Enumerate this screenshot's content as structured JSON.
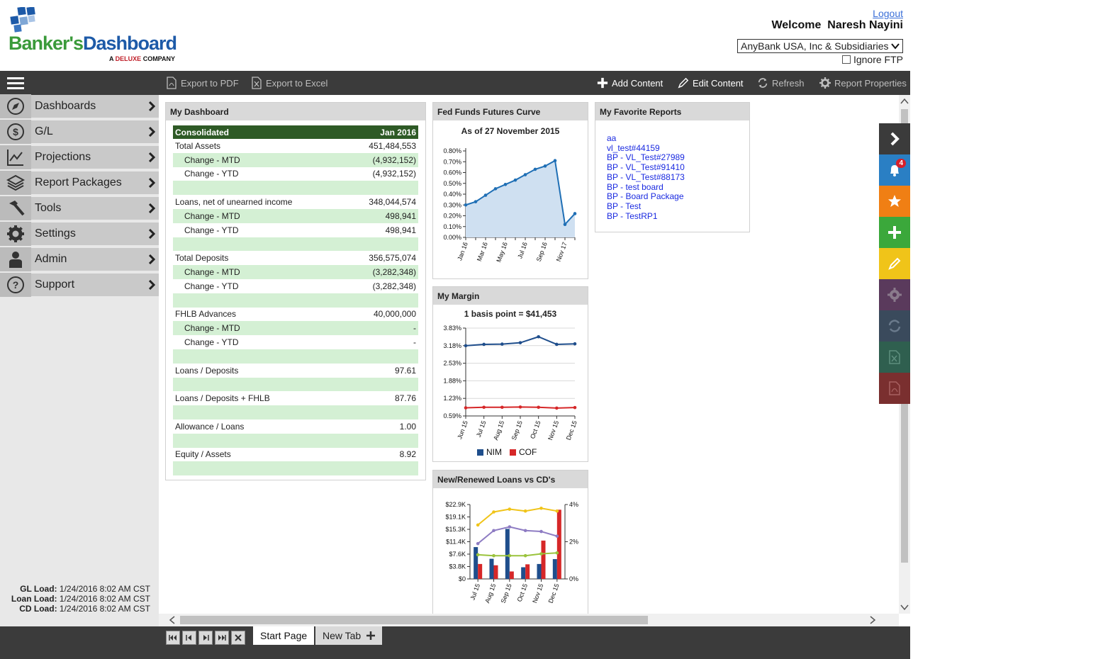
{
  "header": {
    "logo_part1": "Banker's",
    "logo_part2": "Dashboard",
    "logo_sub_a": "A ",
    "logo_sub_brand": "DELUXE",
    "logo_sub_b": " COMPANY",
    "logout": "Logout",
    "welcome": "Welcome  Naresh Nayini",
    "bank_selected": "AnyBank USA, Inc & Subsidiaries",
    "ignore_ftp": "Ignore FTP"
  },
  "toolbar": {
    "export_pdf": "Export to PDF",
    "export_excel": "Export to Excel",
    "add_content": "Add Content",
    "edit_content": "Edit Content",
    "refresh": "Refresh",
    "report_properties": "Report Properties"
  },
  "sidebar": {
    "items": [
      {
        "label": "Dashboards",
        "icon": "compass-icon"
      },
      {
        "label": "G/L",
        "icon": "dollar-icon"
      },
      {
        "label": "Projections",
        "icon": "line-chart-icon"
      },
      {
        "label": "Report Packages",
        "icon": "layers-icon"
      },
      {
        "label": "Tools",
        "icon": "hammer-icon"
      },
      {
        "label": "Settings",
        "icon": "gear-icon"
      },
      {
        "label": "Admin",
        "icon": "user-icon"
      },
      {
        "label": "Support",
        "icon": "question-icon"
      }
    ],
    "loads": [
      {
        "label": "GL Load:",
        "value": "1/24/2016 8:02 AM CST"
      },
      {
        "label": "Loan Load:",
        "value": "1/24/2016 8:02 AM CST"
      },
      {
        "label": "CD Load:",
        "value": "1/24/2016 8:02 AM CST"
      }
    ]
  },
  "my_dashboard": {
    "title": "My Dashboard",
    "col_label": "Consolidated",
    "col_period": "Jan 2016",
    "rows": [
      {
        "label": "Total Assets",
        "value": "451,484,553",
        "indent": false,
        "alt": false
      },
      {
        "label": "Change - MTD",
        "value": "(4,932,152)",
        "indent": true,
        "alt": true
      },
      {
        "label": "Change - YTD",
        "value": "(4,932,152)",
        "indent": true,
        "alt": false
      },
      {
        "label": "",
        "value": "",
        "indent": false,
        "alt": true
      },
      {
        "label": "Loans, net of unearned income",
        "value": "348,044,574",
        "indent": false,
        "alt": false
      },
      {
        "label": "Change - MTD",
        "value": "498,941",
        "indent": true,
        "alt": true
      },
      {
        "label": "Change - YTD",
        "value": "498,941",
        "indent": true,
        "alt": false
      },
      {
        "label": "",
        "value": "",
        "indent": false,
        "alt": true
      },
      {
        "label": "Total Deposits",
        "value": "356,575,074",
        "indent": false,
        "alt": false
      },
      {
        "label": "Change - MTD",
        "value": "(3,282,348)",
        "indent": true,
        "alt": true
      },
      {
        "label": "Change - YTD",
        "value": "(3,282,348)",
        "indent": true,
        "alt": false
      },
      {
        "label": "",
        "value": "",
        "indent": false,
        "alt": true
      },
      {
        "label": "FHLB Advances",
        "value": "40,000,000",
        "indent": false,
        "alt": false
      },
      {
        "label": "Change - MTD",
        "value": "-",
        "indent": true,
        "alt": true
      },
      {
        "label": "Change - YTD",
        "value": "-",
        "indent": true,
        "alt": false
      },
      {
        "label": "",
        "value": "",
        "indent": false,
        "alt": true
      },
      {
        "label": "Loans / Deposits",
        "value": "97.61",
        "indent": false,
        "alt": false
      },
      {
        "label": "",
        "value": "",
        "indent": false,
        "alt": true
      },
      {
        "label": "Loans / Deposits + FHLB",
        "value": "87.76",
        "indent": false,
        "alt": false
      },
      {
        "label": "",
        "value": "",
        "indent": false,
        "alt": true
      },
      {
        "label": "Allowance / Loans",
        "value": "1.00",
        "indent": false,
        "alt": false
      },
      {
        "label": "",
        "value": "",
        "indent": false,
        "alt": true
      },
      {
        "label": "Equity / Assets",
        "value": "8.92",
        "indent": false,
        "alt": false
      },
      {
        "label": "",
        "value": "",
        "indent": false,
        "alt": true
      }
    ]
  },
  "favorites": {
    "title": "My Favorite Reports",
    "items": [
      "aa",
      "vl_test#44159",
      "BP - VL_Test#27989",
      "BP - VL_Test#91410",
      "BP - VL_Test#88173",
      "BP - test board",
      "BP - Board Package",
      "BP - Test",
      "BP - TestRP1"
    ]
  },
  "panels": {
    "fed_title": "Fed Funds Futures Curve",
    "margin_title": "My Margin",
    "loans_title": "New/Renewed Loans vs CD's"
  },
  "rail": {
    "badge_count": "4",
    "colors": [
      "#3b3b3b",
      "#2a7fc4",
      "#f07f14",
      "#3ba83b",
      "#f0c419",
      "#5a3a5c",
      "#3a4a5c",
      "#2f5f4f",
      "#7a2f2f"
    ]
  },
  "tabs": [
    {
      "label": "Start Page",
      "active": true
    },
    {
      "label": "New Tab",
      "active": false
    }
  ],
  "chart_data": [
    {
      "type": "area",
      "title": "As of 27 November 2015",
      "x": [
        "Jan 16",
        "Feb 16",
        "Mar 16",
        "Apr 16",
        "May 16",
        "Jun 16",
        "Jul 16",
        "Aug 16",
        "Sep 16",
        "Oct 16",
        "Nov 17",
        "Dec 17"
      ],
      "tick_labels": [
        "Jan 16",
        "Mar 16",
        "May 16",
        "Jul 16",
        "Sep 16",
        "Nov 17"
      ],
      "values": [
        0.3,
        0.33,
        0.39,
        0.45,
        0.49,
        0.53,
        0.58,
        0.63,
        0.66,
        0.71,
        0.12,
        0.22
      ],
      "ylim": [
        0,
        0.8
      ],
      "yticks": [
        "0.00%",
        "0.10%",
        "0.20%",
        "0.30%",
        "0.40%",
        "0.50%",
        "0.60%",
        "0.70%",
        "0.80%"
      ],
      "color": "#1f6fb5"
    },
    {
      "type": "line",
      "title": "1 basis point = $41,453",
      "categories": [
        "Jun 15",
        "Jul 15",
        "Aug 15",
        "Sep 15",
        "Oct 15",
        "Nov 15",
        "Dec 15"
      ],
      "yticks": [
        "0.59%",
        "1.23%",
        "1.88%",
        "2.53%",
        "3.18%",
        "3.83%"
      ],
      "ylim": [
        0.59,
        3.83
      ],
      "series": [
        {
          "name": "NIM",
          "color": "#1f4e8c",
          "values": [
            3.18,
            3.23,
            3.24,
            3.29,
            3.51,
            3.23,
            3.25
          ]
        },
        {
          "name": "COF",
          "color": "#d62728",
          "values": [
            0.89,
            0.91,
            0.91,
            0.92,
            0.91,
            0.88,
            0.9
          ]
        }
      ]
    },
    {
      "type": "bar",
      "categories": [
        "Jul 15",
        "Aug 15",
        "Sep 15",
        "Oct 15",
        "Nov 15",
        "Dec 15"
      ],
      "yticks_left": [
        "$0",
        "$3.8K",
        "$7.6K",
        "$11.4K",
        "$15.3K",
        "$19.1K",
        "$22.9K"
      ],
      "ylim_left": [
        0,
        22.9
      ],
      "yticks_right": [
        "0%",
        "2%",
        "4%"
      ],
      "ylim_right": [
        0,
        4
      ],
      "bars": [
        {
          "color": "#1f4e8c",
          "values": [
            9.8,
            6.2,
            15.4,
            3.6,
            4.6,
            6.1
          ]
        },
        {
          "color": "#d62728",
          "values": [
            4.6,
            4.2,
            2.3,
            4.5,
            11.8,
            21.3
          ]
        }
      ],
      "lines": [
        {
          "color": "#f0c419",
          "values": [
            2.9,
            3.6,
            3.75,
            3.65,
            3.8,
            3.65
          ]
        },
        {
          "color": "#8e7cc3",
          "values": [
            1.9,
            2.6,
            2.8,
            2.6,
            2.55,
            2.3
          ]
        },
        {
          "color": "#9ac33c",
          "values": [
            1.3,
            1.25,
            1.25,
            1.25,
            1.35,
            1.4
          ]
        }
      ]
    }
  ]
}
